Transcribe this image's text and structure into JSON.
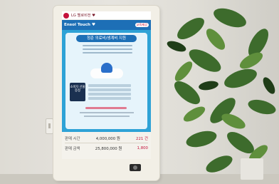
{
  "kiosk": {
    "logo_text": "LG 헬로비전 ♥",
    "screen": {
      "brand": "Ensol Touch ♥",
      "badge": "교육제공",
      "panel_title": "청춘 의료비/생계비 지원",
      "promo_box": "소비자 선물 증정",
      "cta": "자세히보기"
    },
    "info": {
      "row1_label": "판매 시간",
      "row1_value": "4,000,000 원",
      "row1_extra": "221 건",
      "row2_label": "판매 금액",
      "row2_value": "25,800,000 원",
      "row2_extra": "1,800"
    }
  }
}
